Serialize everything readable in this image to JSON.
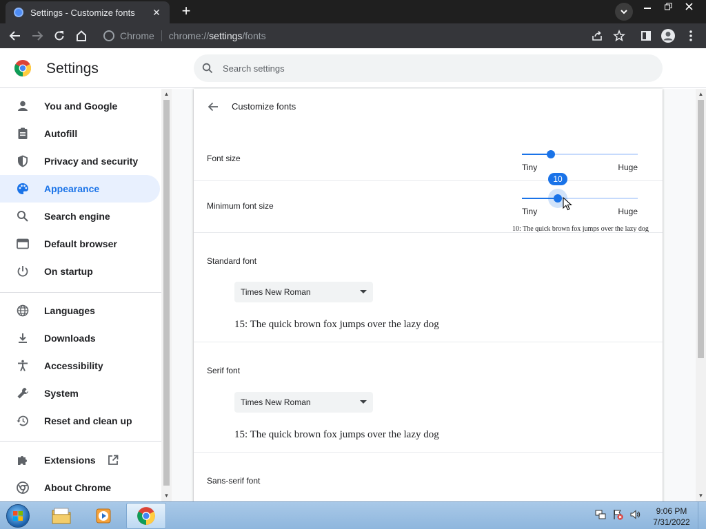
{
  "browser": {
    "tab_title": "Settings - Customize fonts",
    "omnibox": {
      "site_label": "Chrome",
      "url_scheme": "chrome://",
      "url_host": "settings",
      "url_path": "/fonts"
    }
  },
  "header": {
    "title": "Settings",
    "search_placeholder": "Search settings"
  },
  "sidebar": {
    "items": [
      {
        "label": "You and Google",
        "icon": "person-icon"
      },
      {
        "label": "Autofill",
        "icon": "clipboard-icon"
      },
      {
        "label": "Privacy and security",
        "icon": "shield-icon"
      },
      {
        "label": "Appearance",
        "icon": "palette-icon",
        "active": true
      },
      {
        "label": "Search engine",
        "icon": "search-icon"
      },
      {
        "label": "Default browser",
        "icon": "browser-icon"
      },
      {
        "label": "On startup",
        "icon": "power-icon"
      },
      {
        "label": "Languages",
        "icon": "globe-icon"
      },
      {
        "label": "Downloads",
        "icon": "download-icon"
      },
      {
        "label": "Accessibility",
        "icon": "accessibility-icon"
      },
      {
        "label": "System",
        "icon": "wrench-icon"
      },
      {
        "label": "Reset and clean up",
        "icon": "restore-icon"
      },
      {
        "label": "Extensions",
        "icon": "puzzle-icon",
        "external_icon": "open-in-new-icon"
      },
      {
        "label": "About Chrome",
        "icon": "chrome-icon"
      }
    ]
  },
  "main": {
    "page_title": "Customize fonts",
    "font_size": {
      "label": "Font size",
      "min_label": "Tiny",
      "max_label": "Huge",
      "value_fraction": 0.25
    },
    "minimum_font_size": {
      "label": "Minimum font size",
      "min_label": "Tiny",
      "max_label": "Huge",
      "value": "10",
      "value_fraction": 0.31,
      "preview": "10: The quick brown fox jumps over the lazy dog"
    },
    "standard_font": {
      "label": "Standard font",
      "selected": "Times New Roman",
      "preview": "15: The quick brown fox jumps over the lazy dog"
    },
    "serif_font": {
      "label": "Serif font",
      "selected": "Times New Roman",
      "preview": "15: The quick brown fox jumps over the lazy dog"
    },
    "sans_serif_font": {
      "label": "Sans-serif font"
    }
  },
  "taskbar": {
    "time": "9:06 PM",
    "date": "7/31/2022"
  },
  "colors": {
    "accent": "#1a73e8",
    "active_bg": "#e8f0fe",
    "titlebar": "#1f1f1f",
    "toolbar": "#35363a"
  }
}
